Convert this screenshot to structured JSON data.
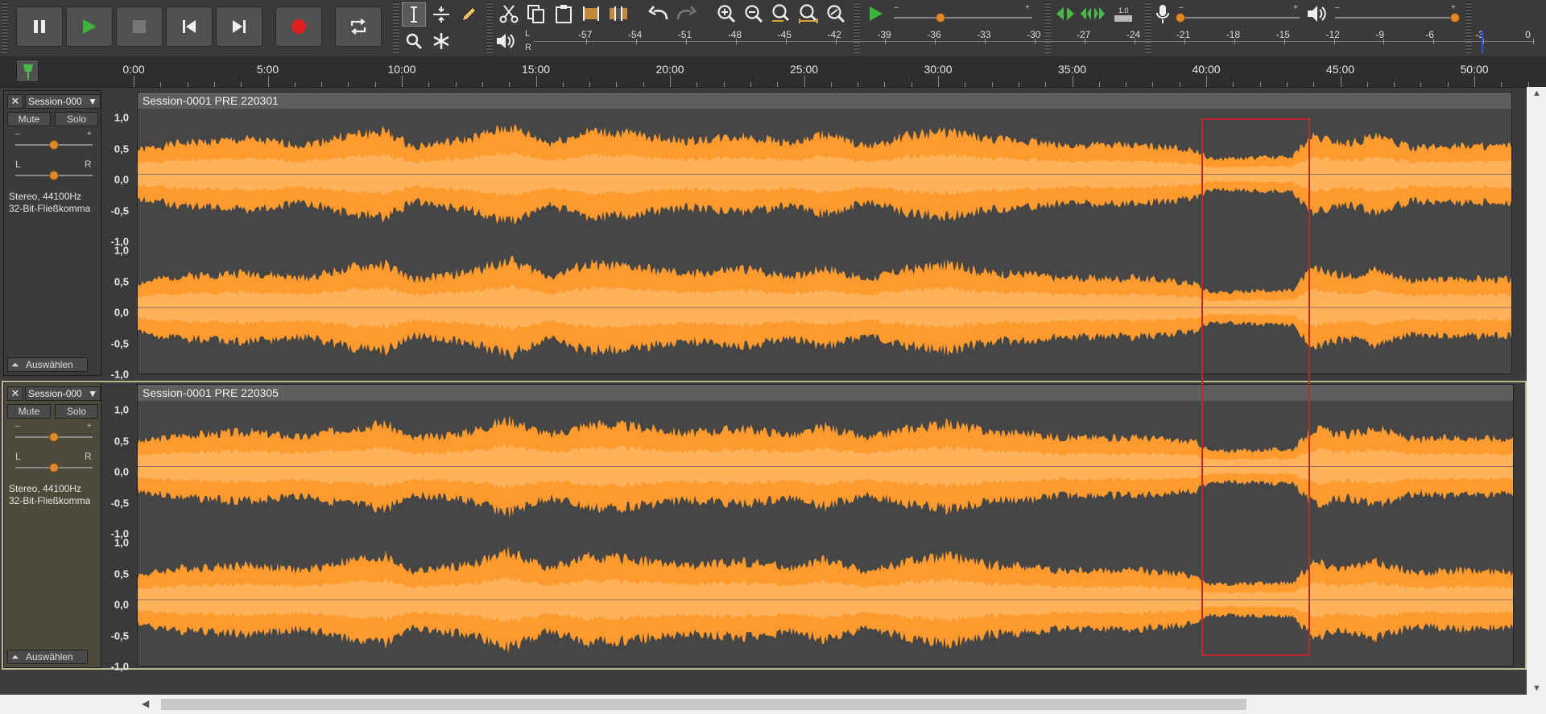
{
  "transport": {
    "pause": "pause-icon",
    "play": "play-icon",
    "stop": "stop-icon",
    "skip_start": "skip-start-icon",
    "skip_end": "skip-end-icon",
    "record": "record-icon",
    "loop": "loop-icon"
  },
  "meter": {
    "left_label": "L",
    "right_label": "R",
    "ticks": [
      "-57",
      "-54",
      "-51",
      "-48",
      "-45",
      "-42",
      "-39",
      "-36",
      "-33",
      "-30",
      "-27",
      "-24",
      "-21",
      "-18",
      "-15",
      "-12",
      "-9",
      "-6",
      "-3",
      "0"
    ]
  },
  "playback_speed": {
    "minus": "–",
    "plus": "+"
  },
  "mixer": {
    "rec_minus": "–",
    "rec_plus": "+",
    "play_minus": "–",
    "play_plus": "+",
    "sync_label": "1.0"
  },
  "ruler": {
    "labels": [
      "0:00",
      "5:00",
      "10:00",
      "15:00",
      "20:00",
      "25:00",
      "30:00",
      "35:00",
      "40:00",
      "45:00",
      "50:00"
    ]
  },
  "tracks": [
    {
      "name": "Session-000",
      "clip_title": "Session-0001 PRE 220301",
      "mute": "Mute",
      "solo": "Solo",
      "gain_minus": "–",
      "gain_plus": "+",
      "pan_left": "L",
      "pan_right": "R",
      "format_line1": "Stereo, 44100Hz",
      "format_line2": "32-Bit-Fließkomma",
      "select": "Auswählen",
      "scale": [
        "1,0",
        "0,5",
        "0,0",
        "-0,5",
        "-1,0"
      ]
    },
    {
      "name": "Session-000",
      "clip_title": "Session-0001 PRE 220305",
      "mute": "Mute",
      "solo": "Solo",
      "gain_minus": "–",
      "gain_plus": "+",
      "pan_left": "L",
      "pan_right": "R",
      "format_line1": "Stereo, 44100Hz",
      "format_line2": "32-Bit-Fließkomma",
      "select": "Auswählen",
      "scale": [
        "1,0",
        "0,5",
        "0,0",
        "-0,5",
        "-1,0"
      ]
    }
  ],
  "colors": {
    "waveform": "#ff9a2e",
    "waveform_rms": "#ffb25a",
    "selection_box": "#c0282c"
  }
}
